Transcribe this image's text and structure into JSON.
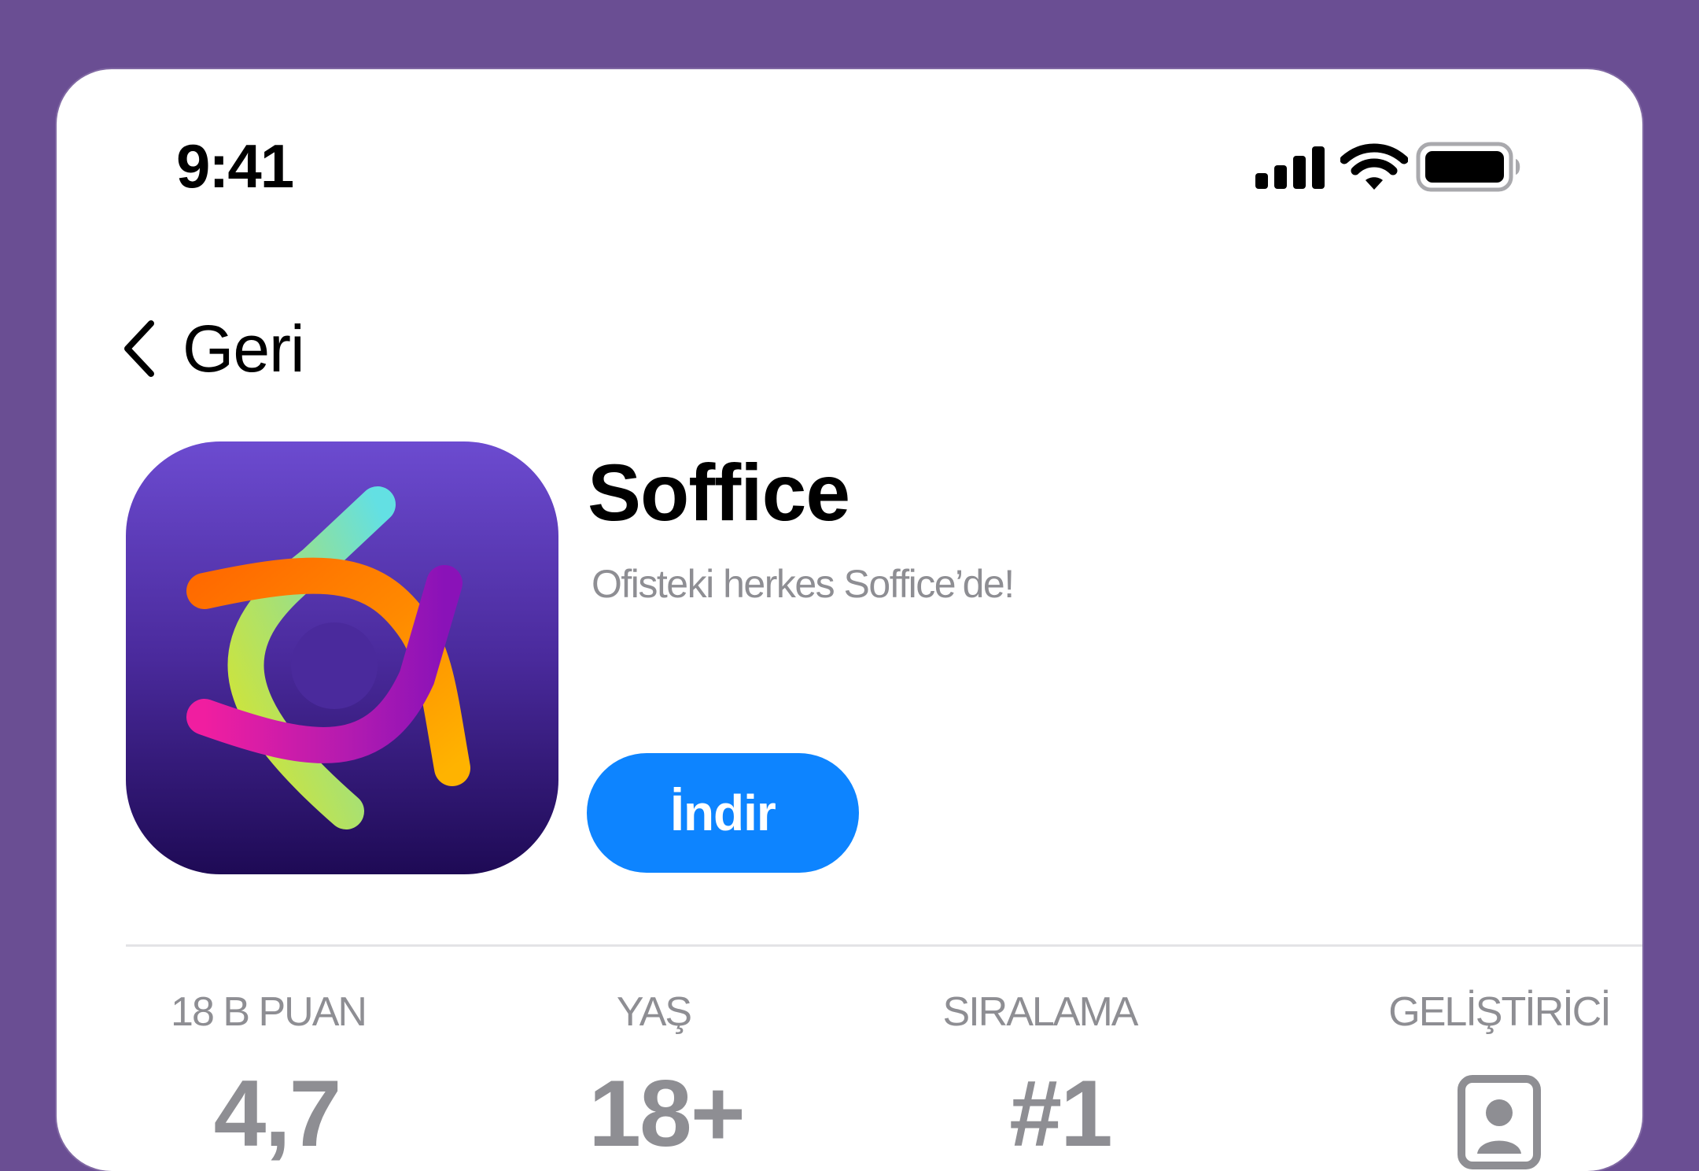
{
  "status_bar": {
    "time": "9:41",
    "icons": [
      "cellular-signal-icon",
      "wifi-icon",
      "battery-icon"
    ]
  },
  "nav": {
    "back_label": "Geri",
    "back_icon": "chevron-left-icon"
  },
  "app": {
    "name": "Soffice",
    "subtitle": "Ofisteki herkes Soffice’de!",
    "get_label": "İndir",
    "icon": "soffice-logo-icon"
  },
  "stats": [
    {
      "label": "18 B PUAN",
      "value": "4,7"
    },
    {
      "label": "YAŞ",
      "value": "18+"
    },
    {
      "label": "SIRALAMA",
      "value": "#1"
    },
    {
      "label": "GELİŞTİRİCİ",
      "icon": "developer-profile-icon"
    }
  ],
  "colors": {
    "background": "#6a4e93",
    "accent": "#0d84ff",
    "secondary_text": "#8e8e93"
  }
}
